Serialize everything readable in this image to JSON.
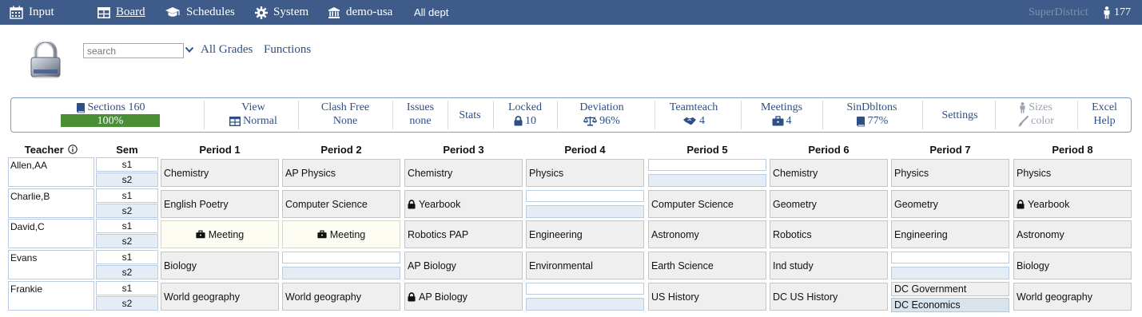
{
  "nav": {
    "input": "Input",
    "board": "Board",
    "schedules": "Schedules",
    "system": "System",
    "district": "demo-usa",
    "dept": "All dept",
    "brand": "SuperDistrict",
    "user_count": "177",
    "icons": [
      "calendar-icon",
      "board-icon",
      "graduation-cap-icon",
      "gear-icon",
      "institution-icon",
      "person-icon"
    ]
  },
  "header": {
    "search_placeholder": "search",
    "grades": "All Grades",
    "functions": "Functions"
  },
  "stats": {
    "sections": "Sections 160",
    "sections_progress_label": "100%",
    "sections_progress": 1.0,
    "view": "View",
    "view_value": "Normal",
    "clash_free": "Clash Free",
    "clash_free_value": "None",
    "issues": "Issues",
    "issues_value": "none",
    "stats_label": "Stats",
    "locked": "Locked",
    "locked_value": "10",
    "deviation": "Deviation",
    "deviation_value": "96%",
    "teamteach": "Teamteach",
    "teamteach_value": "4",
    "meetings": "Meetings",
    "meetings_value": "4",
    "sindbltons": "SinDbltons",
    "sindbltons_value": "77%",
    "settings": "Settings",
    "sizes": "Sizes",
    "color": "color",
    "excel": "Excel",
    "help": "Help"
  },
  "grid": {
    "teacher_header": "Teacher",
    "sem_header": "Sem",
    "periods": [
      "Period 1",
      "Period 2",
      "Period 3",
      "Period 4",
      "Period 5",
      "Period 6",
      "Period 7",
      "Period 8"
    ],
    "sems": [
      "s1",
      "s2"
    ],
    "teachers": [
      {
        "name": "Allen,AA",
        "cells": [
          {
            "text": "Chemistry"
          },
          {
            "text": "AP Physics"
          },
          {
            "text": "Chemistry"
          },
          {
            "text": "Physics"
          },
          {
            "empty": true
          },
          {
            "text": "Chemistry"
          },
          {
            "text": "Physics"
          },
          {
            "text": "Physics"
          }
        ]
      },
      {
        "name": "Charlie,B",
        "cells": [
          {
            "text": "English Poetry"
          },
          {
            "text": "Computer Science"
          },
          {
            "text": "Yearbook",
            "locked": true
          },
          {
            "empty": true
          },
          {
            "text": "Computer Science"
          },
          {
            "text": "Geometry"
          },
          {
            "text": "Geometry"
          },
          {
            "text": "Yearbook",
            "locked": true
          }
        ]
      },
      {
        "name": "David,C",
        "cells": [
          {
            "text": "Meeting",
            "meeting": true
          },
          {
            "text": "Meeting",
            "meeting": true
          },
          {
            "text": "Robotics PAP"
          },
          {
            "text": "Engineering"
          },
          {
            "text": "Astronomy"
          },
          {
            "text": "Robotics"
          },
          {
            "text": "Engineering"
          },
          {
            "text": "Astronomy"
          }
        ]
      },
      {
        "name": "Evans",
        "cells": [
          {
            "text": "Biology"
          },
          {
            "empty": true
          },
          {
            "text": "AP Biology"
          },
          {
            "text": "Environmental"
          },
          {
            "text": "Earth Science"
          },
          {
            "text": "Ind study"
          },
          {
            "empty": true
          },
          {
            "text": "Biology"
          }
        ]
      },
      {
        "name": "Frankie",
        "cells": [
          {
            "text": "World geography"
          },
          {
            "text": "World geography"
          },
          {
            "text": "AP Biology",
            "locked": true
          },
          {
            "empty": true
          },
          {
            "text": "US History"
          },
          {
            "text": "DC US History"
          },
          {
            "split": [
              "DC Government",
              "DC Economics"
            ]
          },
          {
            "text": "World geography"
          }
        ]
      }
    ]
  }
}
